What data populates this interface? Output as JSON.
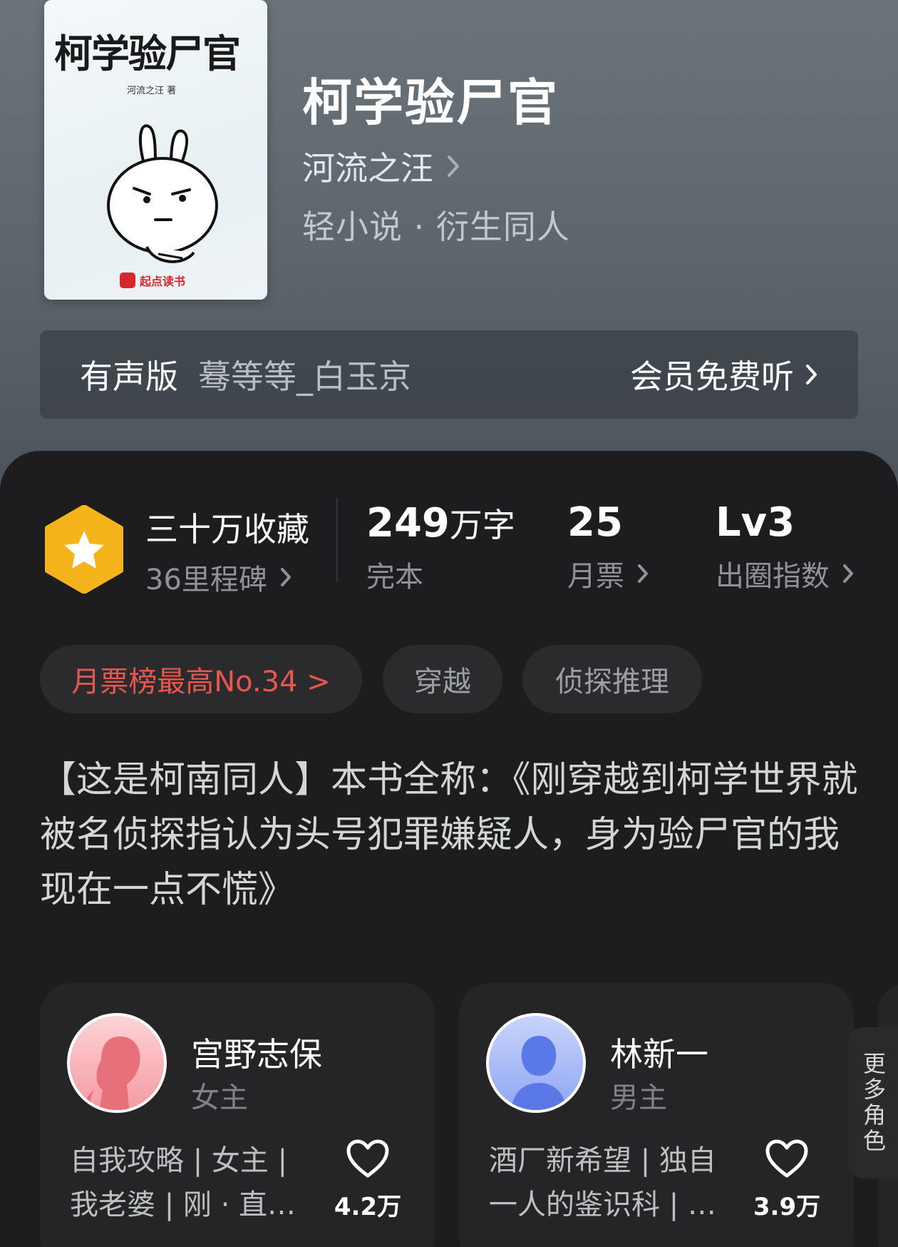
{
  "cover": {
    "title": "柯学验尸官",
    "author_line": "河流之汪 著",
    "publisher": "起点读书"
  },
  "book": {
    "title": "柯学验尸官",
    "author": "河流之汪",
    "genre": "轻小说 · 衍生同人"
  },
  "audio": {
    "label": "有声版",
    "narrator": "蓦等等_白玉京",
    "cta": "会员免费听"
  },
  "stats": {
    "favorites": "三十万收藏",
    "milestones": "36里程碑",
    "word_count_num": "249",
    "word_count_unit": "万字",
    "status": "完本",
    "monthly_votes": "25",
    "monthly_votes_label": "月票",
    "level": "Lv3",
    "level_label": "出圈指数"
  },
  "tags": [
    {
      "label": "月票榜最高No.34 >",
      "highlight": true
    },
    {
      "label": "穿越"
    },
    {
      "label": "侦探推理"
    }
  ],
  "synopsis": "【这是柯南同人】本书全称：《刚穿越到柯学世界就被名侦探指认为头号犯罪嫌疑人，身为验尸官的我现在一点不慌》",
  "characters": [
    {
      "name": "宫野志保",
      "role": "女主",
      "desc_line1": "自我攻略 | 女主 |",
      "desc_line2": "我老婆 | 刚 · 直…",
      "likes": "4.2万",
      "avatar_color": "#f59aa2"
    },
    {
      "name": "林新一",
      "role": "男主",
      "desc_line1": "酒厂新希望 | 独自",
      "desc_line2": "一人的鉴识科 | …",
      "likes": "3.9万",
      "avatar_color": "#8fa6f4"
    }
  ],
  "more_characters": "更多角色",
  "colors": {
    "accent_red": "#e8574f",
    "badge_gold": "#f5b41c",
    "panel_bg": "#1d1d1f"
  }
}
